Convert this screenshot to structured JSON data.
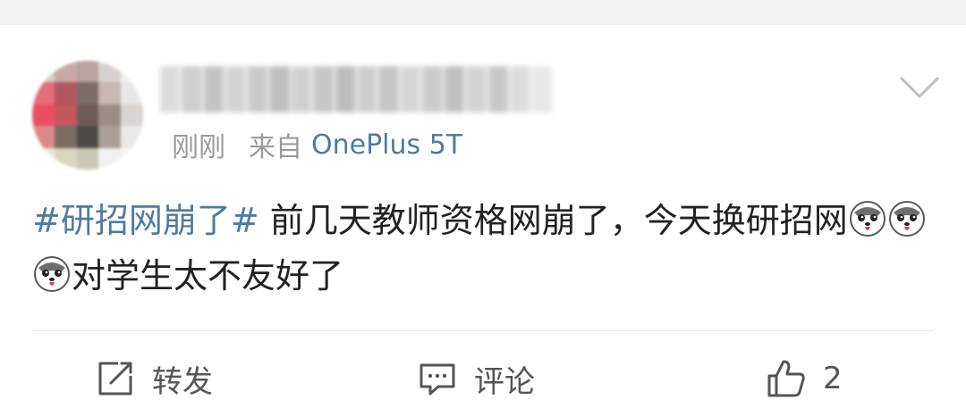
{
  "post": {
    "time": "刚刚",
    "source_prefix": "来自",
    "device": "OnePlus 5T",
    "topic": "#研招网崩了#",
    "text_before_emoji": " 前几天教师资格网崩了，今天换研招网",
    "text_after_emoji": "对学生太不友好了",
    "emoji_count": 3,
    "emoji_icon": "husky-emoji-icon"
  },
  "actions": {
    "repost_label": "转发",
    "comment_label": "评论",
    "like_count": "2"
  },
  "colors": {
    "link": "#4f7ba1",
    "text": "#222222",
    "meta": "#9a9a9a",
    "action": "#555555",
    "divider": "#e6e6e6"
  }
}
